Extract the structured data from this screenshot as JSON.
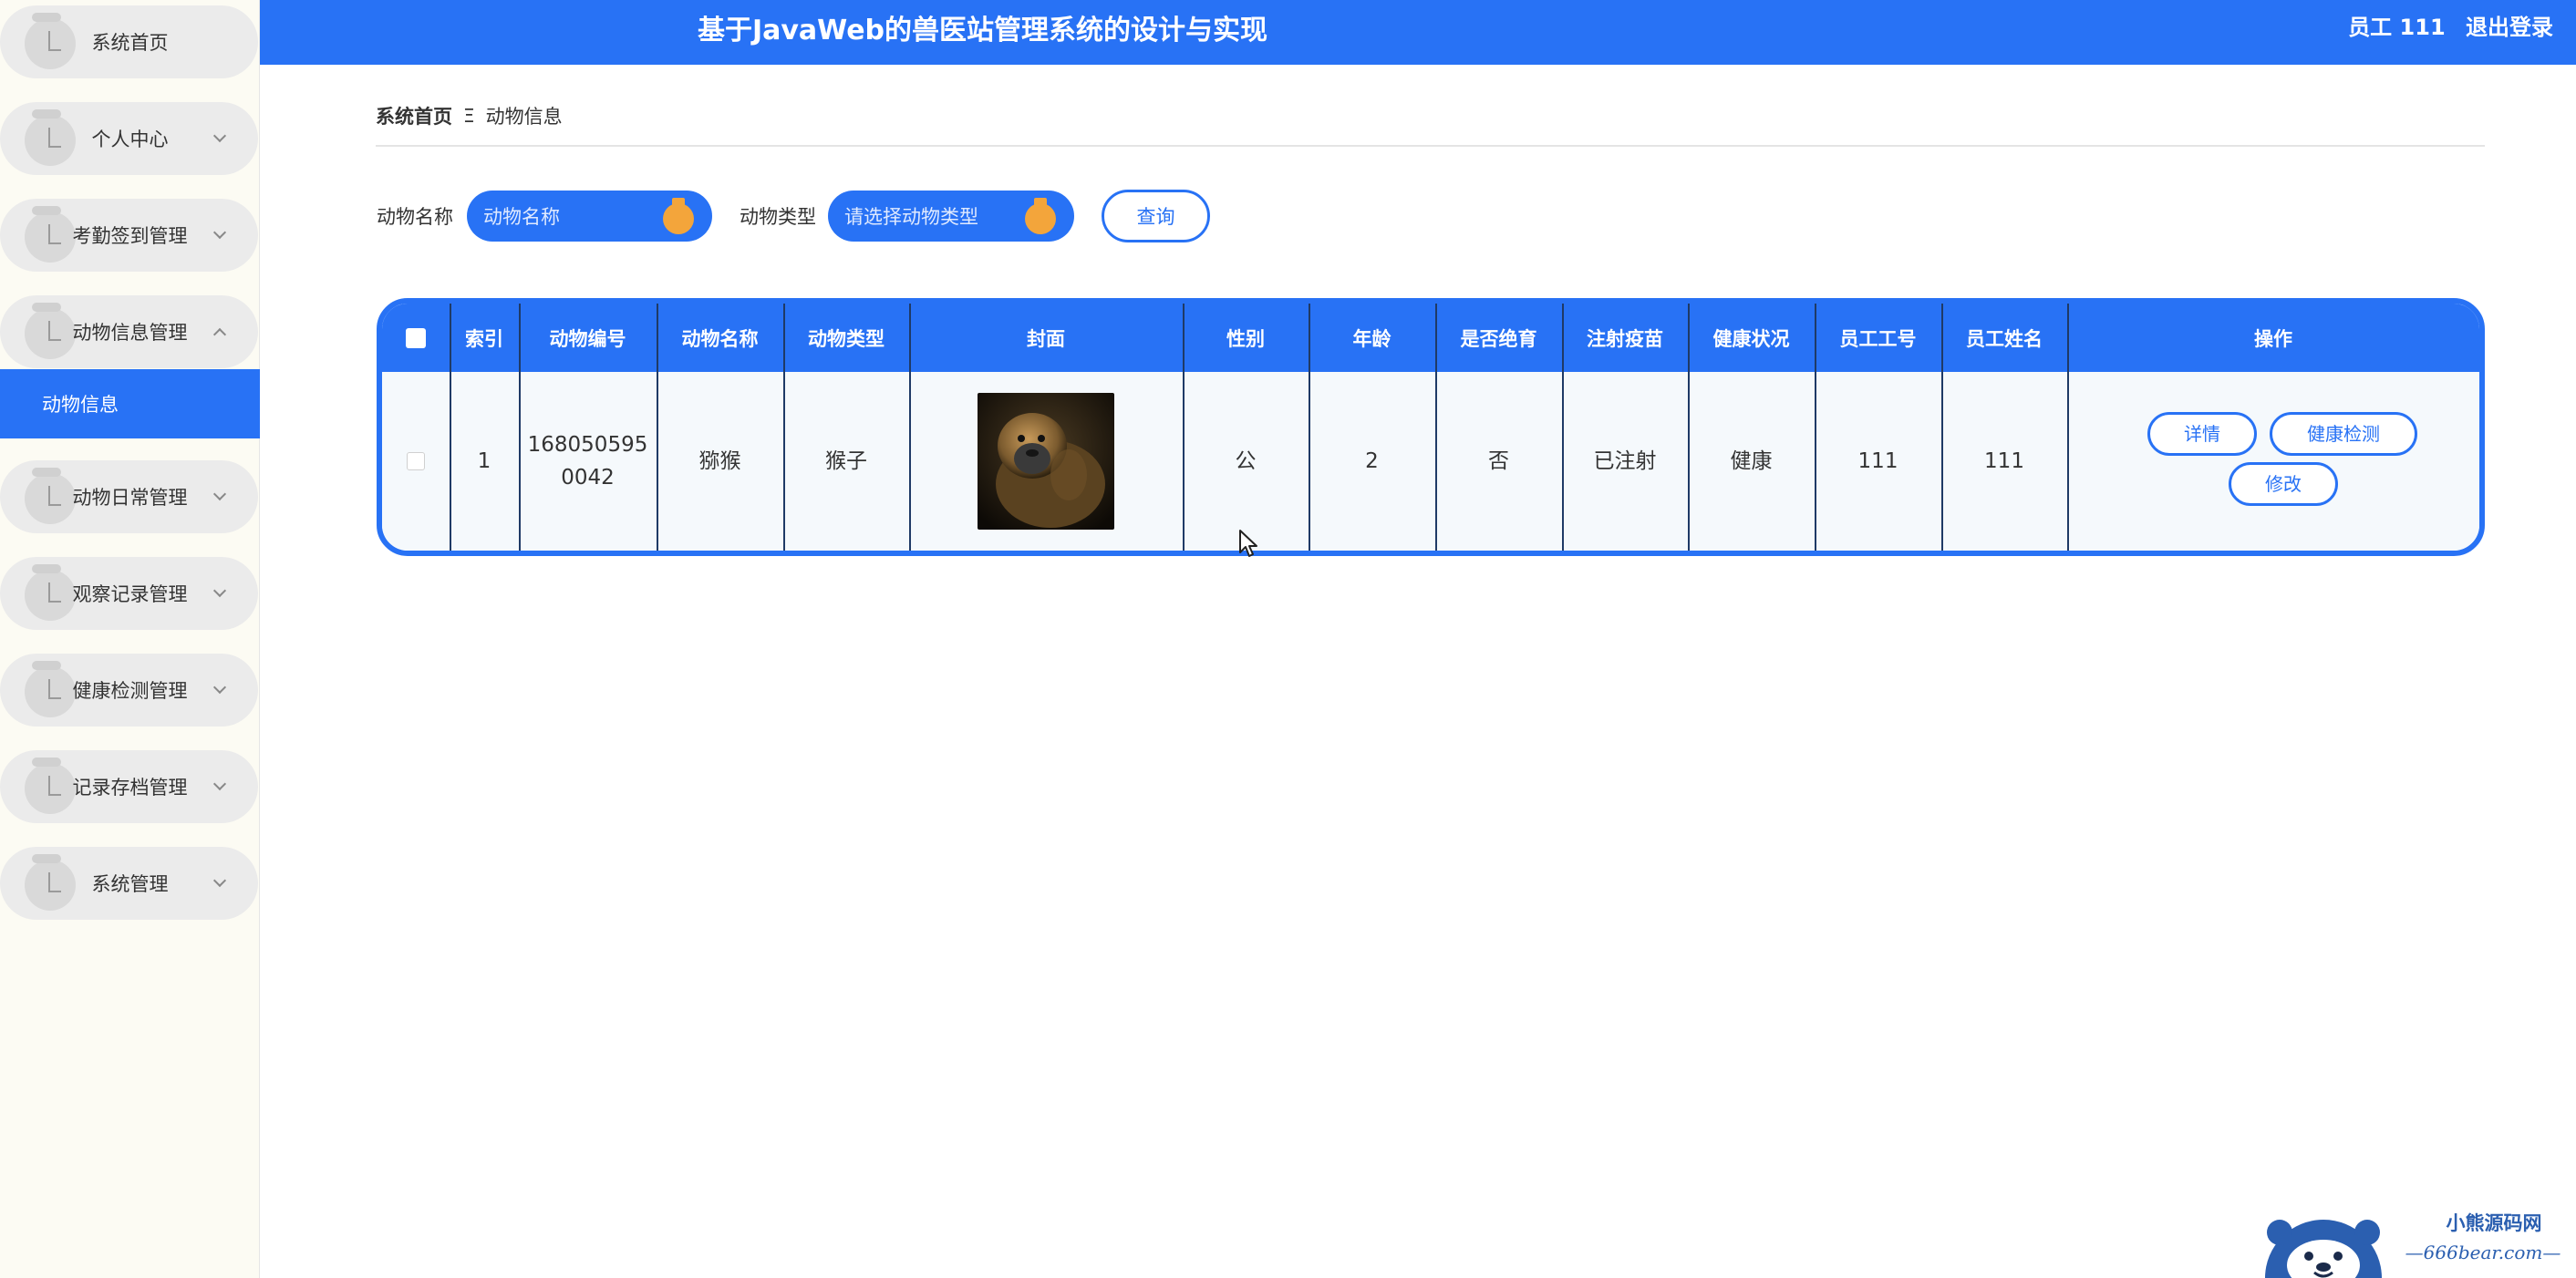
{
  "header": {
    "title": "基于JavaWeb的兽医站管理系统的设计与实现",
    "user": "员工 111",
    "logout": "退出登录"
  },
  "sidebar": {
    "items": [
      {
        "label": "系统首页"
      },
      {
        "label": "个人中心"
      },
      {
        "label": "考勤签到管理"
      },
      {
        "label": "动物信息管理"
      },
      {
        "label": "动物日常管理"
      },
      {
        "label": "观察记录管理"
      },
      {
        "label": "健康检测管理"
      },
      {
        "label": "记录存档管理"
      },
      {
        "label": "系统管理"
      }
    ],
    "active_sub": "动物信息"
  },
  "breadcrumb": {
    "home": "系统首页",
    "separator": "Ξ",
    "current": "动物信息"
  },
  "search": {
    "name_label": "动物名称",
    "name_placeholder": "动物名称",
    "type_label": "动物类型",
    "type_placeholder": "请选择动物类型",
    "query_button": "查询"
  },
  "table": {
    "headers": [
      "索引",
      "动物编号",
      "动物名称",
      "动物类型",
      "封面",
      "性别",
      "年龄",
      "是否绝育",
      "注射疫苗",
      "健康状况",
      "员工工号",
      "员工姓名",
      "操作"
    ],
    "rows": [
      {
        "index": "1",
        "animal_no_1": "168050595",
        "animal_no_2": "0042",
        "name": "猕猴",
        "type": "猴子",
        "gender": "公",
        "age": "2",
        "sterilized": "否",
        "vaccine": "已注射",
        "health": "健康",
        "staff_no": "111",
        "staff_name": "111"
      }
    ],
    "actions": {
      "detail": "详情",
      "health_check": "健康检测",
      "edit": "修改"
    }
  },
  "watermark": {
    "title": "小熊源码网",
    "url": "—666bear.com—"
  },
  "colors": {
    "primary": "#2872f5",
    "accent": "#f3a53b",
    "sidebar_bg": "#fcfbf3"
  }
}
